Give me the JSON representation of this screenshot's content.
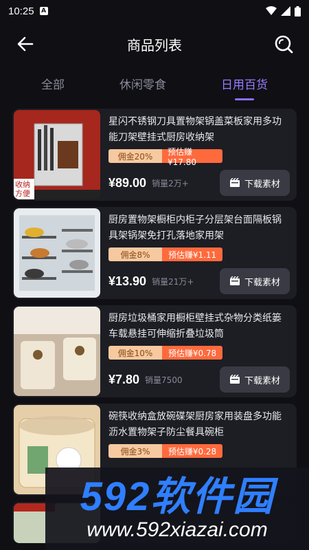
{
  "status": {
    "time": "10:25",
    "notif_letter": "A"
  },
  "header": {
    "title": "商品列表"
  },
  "tabs": [
    {
      "label": "全部",
      "active": false
    },
    {
      "label": "休闲零食",
      "active": false
    },
    {
      "label": "日用百货",
      "active": true
    }
  ],
  "products": [
    {
      "title": "星闪不锈钢刀具置物架锅盖菜板家用多功能刀架壁挂式厨房收纳架",
      "commission": "佣金20%",
      "earn": "预估赚¥17.80",
      "price": "¥89.00",
      "sales": "销量2万+",
      "button": "下载素材",
      "thumb_caption": "收纳方便"
    },
    {
      "title": "厨房置物架橱柜内柜子分层架台面隔板锅具架锅架免打孔落地家用架",
      "commission": "佣金8%",
      "earn": "预估赚¥1.11",
      "price": "¥13.90",
      "sales": "销量21万+",
      "button": "下载素材"
    },
    {
      "title": "厨房垃圾桶家用橱柜壁挂式杂物分类纸篓车载悬挂可伸缩折叠垃圾筒",
      "commission": "佣金10%",
      "earn": "预估赚¥0.78",
      "price": "¥7.80",
      "sales": "销量7500",
      "button": "下载素材"
    },
    {
      "title": "碗筷收纳盒放碗碟架厨房家用装盘多功能沥水置物架子防尘餐具碗柜",
      "commission": "佣金3%",
      "earn": "预估赚¥0.28",
      "price": "",
      "sales": "",
      "button": ""
    }
  ],
  "watermark": {
    "brand": "592软件园",
    "url": "www.592xiazai.com"
  }
}
